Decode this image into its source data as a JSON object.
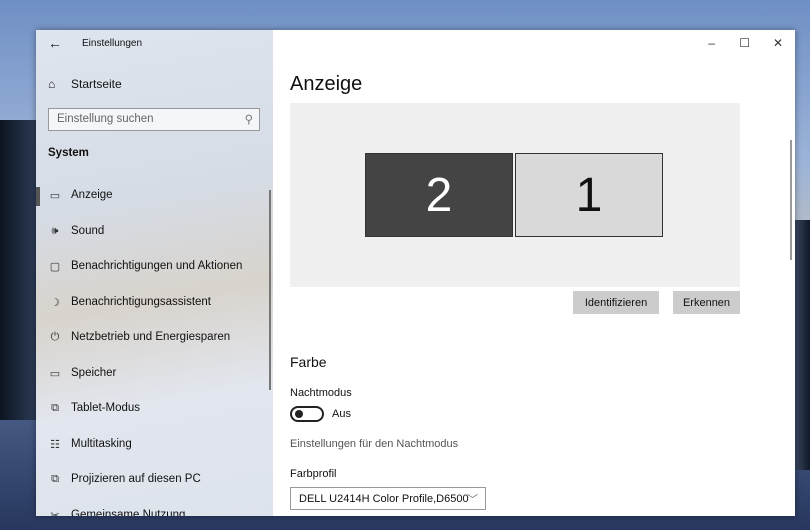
{
  "window": {
    "title": "Einstellungen",
    "minimize": "–",
    "maximize": "☐",
    "close": "✕"
  },
  "sidebar": {
    "back_icon": "←",
    "home_icon": "⌂",
    "home": "Startseite",
    "search_placeholder": "Einstellung suchen",
    "search_icon": "⚲",
    "section": "System",
    "items": [
      {
        "label": "Anzeige",
        "icon": "▭",
        "selected": true
      },
      {
        "label": "Sound",
        "icon": "🕪"
      },
      {
        "label": "Benachrichtigungen und Aktionen",
        "icon": "▢"
      },
      {
        "label": "Benachrichtigungsassistent",
        "icon": "☽"
      },
      {
        "label": "Netzbetrieb und Energiesparen",
        "icon": "⏻"
      },
      {
        "label": "Speicher",
        "icon": "▭"
      },
      {
        "label": "Tablet-Modus",
        "icon": "⧉"
      },
      {
        "label": "Multitasking",
        "icon": "☷"
      },
      {
        "label": "Projizieren auf diesen PC",
        "icon": "⧉"
      },
      {
        "label": "Gemeinsame Nutzung",
        "icon": "✂"
      }
    ]
  },
  "main": {
    "title": "Anzeige",
    "monitors": [
      {
        "label": "2",
        "active": true
      },
      {
        "label": "1",
        "active": false
      }
    ],
    "identify": "Identifizieren",
    "detect": "Erkennen",
    "color_heading": "Farbe",
    "night_mode_label": "Nachtmodus",
    "night_mode_state": "Aus",
    "night_mode_on": false,
    "night_mode_link": "Einstellungen für den Nachtmodus",
    "color_profile_label": "Farbprofil",
    "color_profile_value": "DELL U2414H Color Profile,D6500",
    "chevron": "﹀"
  }
}
